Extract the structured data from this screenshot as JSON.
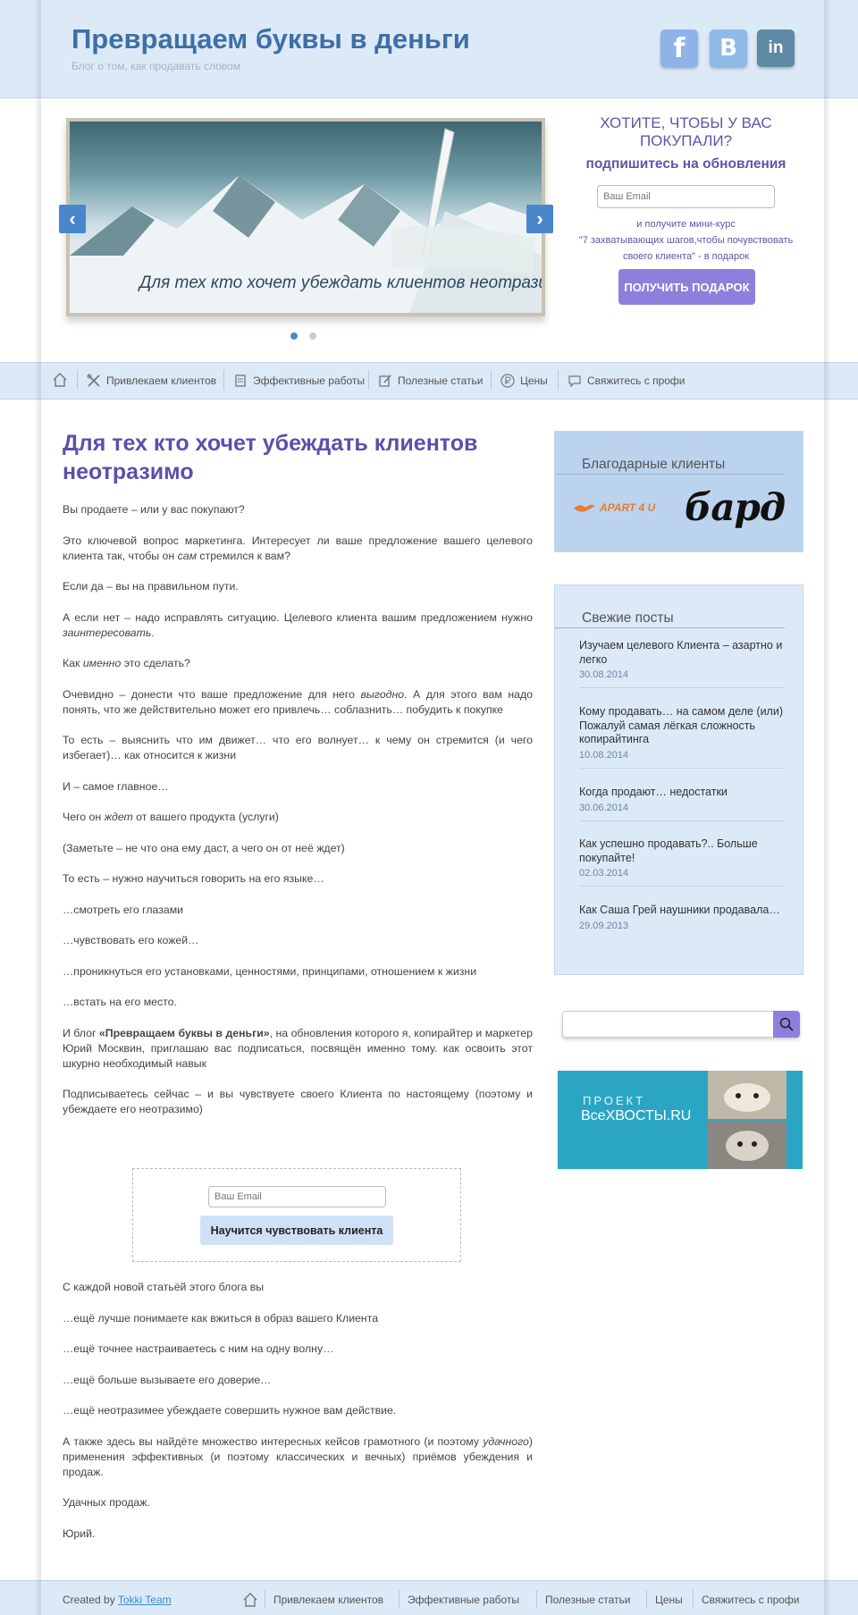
{
  "header": {
    "title": "Превращаем буквы в деньги",
    "tagline": "Блог о том, как продавать словом",
    "social": [
      {
        "icon": "facebook-icon",
        "glyph": "f"
      },
      {
        "icon": "vk-icon",
        "glyph": "B"
      },
      {
        "icon": "linkedin-icon",
        "glyph": "in"
      }
    ]
  },
  "slider": {
    "caption": "Для тех кто хочет убеждать клиентов неотразимо",
    "prev": "‹",
    "next": "›",
    "dots": 2,
    "active_dot": 1
  },
  "subscribe": {
    "heading": "ХОТИТЕ, ЧТОБЫ У ВАС ПОКУПАЛИ?",
    "subheading": "подпишитесь на обновления",
    "email_placeholder": "Ваш Email",
    "note_1": "и получите мини-курс",
    "note_2": "\"7 захватывающих шагов,чтобы почувствовать",
    "note_3": "своего клиента\" - в подарок",
    "button": "ПОЛУЧИТЬ ПОДАРОК"
  },
  "nav": [
    {
      "label": "Привлекаем клиентов",
      "icon": "tools-icon"
    },
    {
      "label": "Эффективные работы",
      "icon": "document-icon"
    },
    {
      "label": "Полезные статьи",
      "icon": "edit-icon"
    },
    {
      "label": "Цены",
      "icon": "ruble-icon"
    },
    {
      "label": "Свяжитесь с профи",
      "icon": "chat-icon"
    }
  ],
  "post": {
    "title": "Для тех кто хочет убеждать клиентов неотразимо",
    "p1": "Вы продаете – или у вас покупают?",
    "p2a": "Это ключевой вопрос маркетинга. Интересует ли ваше предложение вашего целевого клиента так, чтобы он ",
    "p2em": "сам",
    "p2b": " стремился к вам?",
    "p3": "Если да – вы на правильном пути.",
    "p4a": "А если нет – надо исправлять ситуацию. Целевого клиента вашим предложением нужно ",
    "p4em": "заинтересовать",
    "p4b": ".",
    "p5a": "Как ",
    "p5em": "именно",
    "p5b": " это сделать?",
    "p6a": "Очевидно – донести что ваше предложение для него ",
    "p6em": "выгодно",
    "p6b": ". А для этого вам надо понять, что же действительно может его привлечь… соблазнить… побудить к покупке",
    "p7": "То есть – выяснить что им движет… что его волнует… к чему он стремится (и чего избегает)… как относится к жизни",
    "p8": "И – самое главное…",
    "p9a": "Чего он ",
    "p9em": "ждет",
    "p9b": " от вашего продукта (услуги)",
    "p10": "(Заметьте – не что она ему даст, а чего он от неё ждет)",
    "p11": "То есть – нужно научиться говорить на его языке…",
    "p12": "…смотреть его глазами",
    "p13": "…чувствовать его кожей…",
    "p14": "…проникнуться его установками, ценностями, принципами, отношением к жизни",
    "p15": "…встать на его место.",
    "p16a": "И блог ",
    "p16b": "«Превращаем буквы в деньги»",
    "p16c": ", на обновления которого я, копирайтер и маркетер Юрий Москвин, приглашаю вас подписаться, посвящён именно тому. как освоить этот шкурно необходимый навык",
    "p17": "Подписываетесь сейчас – и вы чувствуете своего Клиента по настоящему (поэтому и убеждаете его неотразимо)"
  },
  "optin": {
    "email_placeholder": "Ваш Email",
    "button": "Научится чувствовать клиента"
  },
  "post2": {
    "p1": "С каждой новой статьёй этого блога вы",
    "p2": "…ещё лучше понимаете как вжиться в образ вашего Клиента",
    "p3": "…ещё точнее настраиваетесь с ним на одну волну…",
    "p4": "…ещё больше вызываете его доверие…",
    "p5": "…ещё неотразимее убеждаете совершить нужное вам действие.",
    "p6a": "А также здесь вы найдёте множество интересных кейсов грамотного (и поэтому ",
    "p6em": "удачного",
    "p6b": ") применения эффективных (и поэтому классических и вечных) приёмов убеждения и продаж.",
    "p7": "Удачных продаж.",
    "p8": "Юрий."
  },
  "sidebar": {
    "clients_title": "Благодарные клиенты",
    "client_logo_1": "APART 4 U",
    "client_logo_2": "бард",
    "posts_title": "Свежие посты",
    "posts": [
      {
        "title": "Изучаем целевого Клиента – азартно и легко",
        "date": "30.08.2014"
      },
      {
        "title": "Кому продавать… на самом деле (или) Пожалуй самая лёгкая сложность копирайтинга",
        "date": "10.08.2014"
      },
      {
        "title": "Когда продают… недостатки",
        "date": "30.06.2014"
      },
      {
        "title": "Как успешно продавать?.. Больше покупайте!",
        "date": "02.03.2014"
      },
      {
        "title": "Как Саша Грей наушники продавала…",
        "date": "29.09.2013"
      }
    ],
    "banner_line1": "ПРОЕКТ",
    "banner_line2": "ВсеХВОСТЫ.RU"
  },
  "footer": {
    "created_by": "Created by ",
    "author_link": "Tokki Team",
    "nav": [
      "Привлекаем клиентов",
      "Эффективные работы",
      "Полезные статьи",
      "Цены",
      "Свяжитесь с профи"
    ]
  },
  "colors": {
    "band": "#dce9f7",
    "title_blue": "#3e6fa6",
    "accent_purple": "#5b4fae",
    "button_purple": "#8e7fdc"
  }
}
